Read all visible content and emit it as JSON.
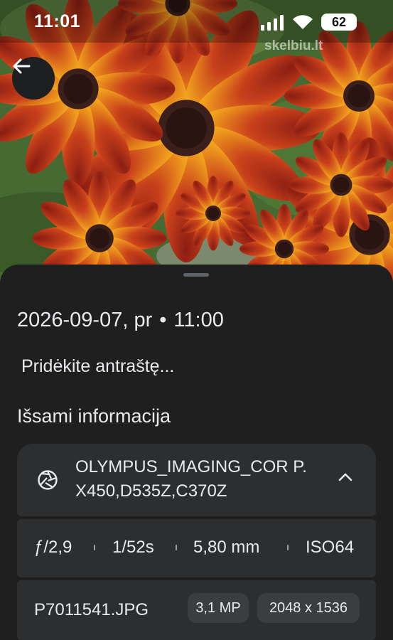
{
  "status_bar": {
    "time": "11:01",
    "battery": "62",
    "icons": [
      "signal-icon",
      "wifi-icon",
      "battery-icon"
    ]
  },
  "photo": {
    "watermark": "skelbiu.lt",
    "subject": "flowers"
  },
  "nav": {
    "back_icon": "arrow-left-icon"
  },
  "info_sheet": {
    "date": "2026-09-07, pr",
    "dot": "•",
    "time": "11:00",
    "caption_placeholder": "Pridėkite antraštę...",
    "section_title": "Išsami informacija",
    "camera": {
      "icon": "aperture-icon",
      "name": "OLYMPUS_IMAGING_COR P.   X450,D535Z,C370Z",
      "expand_icon": "chevron-up-icon"
    },
    "exposure": {
      "aperture": "ƒ/2,9",
      "shutter": "1/52s",
      "focal_length": "5,80 mm",
      "iso": "ISO64"
    },
    "file": {
      "name": "P7011541.JPG",
      "megapixels": "3,1 MP",
      "resolution": "2048 x 1536"
    }
  },
  "colors": {
    "sheet_bg": "#1f1f1f",
    "card_bg": "#2d2e30",
    "chip_bg": "#3c3d3f",
    "text": "#e8eaed",
    "petal_orange": "#f39a1c",
    "petal_red": "#b2301a",
    "flower_center": "#3a1f1a"
  }
}
